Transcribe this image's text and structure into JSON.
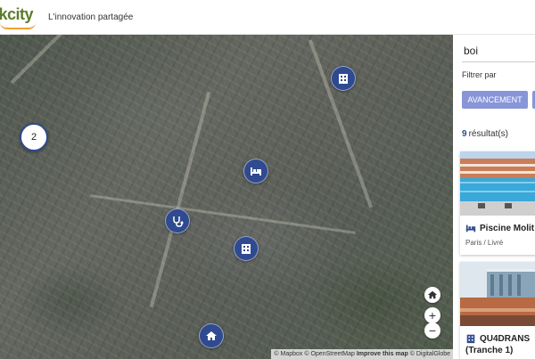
{
  "header": {
    "logo_text": "nkcity",
    "tagline": "L'innovation partagée"
  },
  "map": {
    "cluster_count": "2",
    "markers": [
      {
        "name": "building-icon"
      },
      {
        "name": "bed-icon"
      },
      {
        "name": "stethoscope-icon"
      },
      {
        "name": "building-icon"
      },
      {
        "name": "home-icon"
      }
    ],
    "controls": {
      "home": "home-icon",
      "zoom_in": "+",
      "zoom_out": "−"
    },
    "attribution": {
      "mapbox": "© Mapbox",
      "osm": "© OpenStreetMap",
      "improve": "Improve this map",
      "digitalglobe": "© DigitalGlobe"
    },
    "marker_color": "#2f4a8e"
  },
  "panel": {
    "search_value": "boi",
    "filter_label": "Filtrer par",
    "filter_chip": "AVANCEMENT",
    "result_count": "9",
    "result_label": "résultat(s)",
    "results": [
      {
        "title": "Piscine Molit",
        "subtitle": "Paris / Livré",
        "icon": "bed-icon"
      },
      {
        "title": "QU4DRANS",
        "title_line2": "(Tranche 1)",
        "icon": "building-icon"
      }
    ],
    "accent": "#8896d8"
  }
}
